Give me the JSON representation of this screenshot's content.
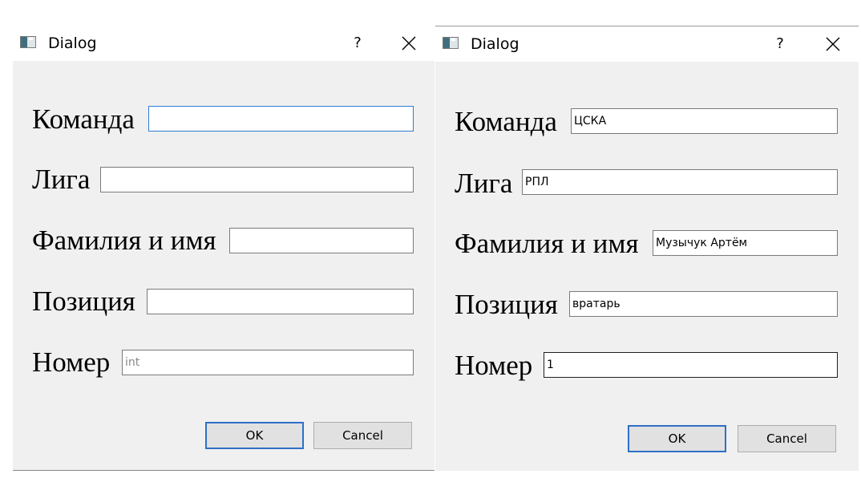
{
  "left_dialog": {
    "title": "Dialog",
    "help_symbol": "?",
    "icons": {
      "app": "window-app-icon",
      "close": "close-icon"
    },
    "fields": [
      {
        "label": "Команда",
        "value": "",
        "placeholder": ""
      },
      {
        "label": "Лига",
        "value": "",
        "placeholder": ""
      },
      {
        "label": "Фамилия и имя",
        "value": "",
        "placeholder": ""
      },
      {
        "label": "Позиция",
        "value": "",
        "placeholder": ""
      },
      {
        "label": "Номер",
        "value": "",
        "placeholder": "int"
      }
    ],
    "buttons": {
      "ok": "OK",
      "cancel": "Cancel"
    }
  },
  "right_dialog": {
    "title": "Dialog",
    "help_symbol": "?",
    "icons": {
      "app": "window-app-icon",
      "close": "close-icon"
    },
    "fields": [
      {
        "label": "Команда",
        "value": "ЦСКА",
        "placeholder": ""
      },
      {
        "label": "Лига",
        "value": "РПЛ",
        "placeholder": ""
      },
      {
        "label": "Фамилия и имя",
        "value": "Музычук Артём",
        "placeholder": ""
      },
      {
        "label": "Позиция",
        "value": "вратарь",
        "placeholder": ""
      },
      {
        "label": "Номер",
        "value": "1",
        "placeholder": ""
      }
    ],
    "buttons": {
      "ok": "OK",
      "cancel": "Cancel"
    }
  },
  "colors": {
    "dialog_background": "#f0f0f0",
    "titlebar_background": "#ffffff",
    "focus_border": "#2f7cd3",
    "default_button_border": "#2f6fc6",
    "input_border": "#7a7a7a",
    "button_background": "#e1e1e1"
  }
}
